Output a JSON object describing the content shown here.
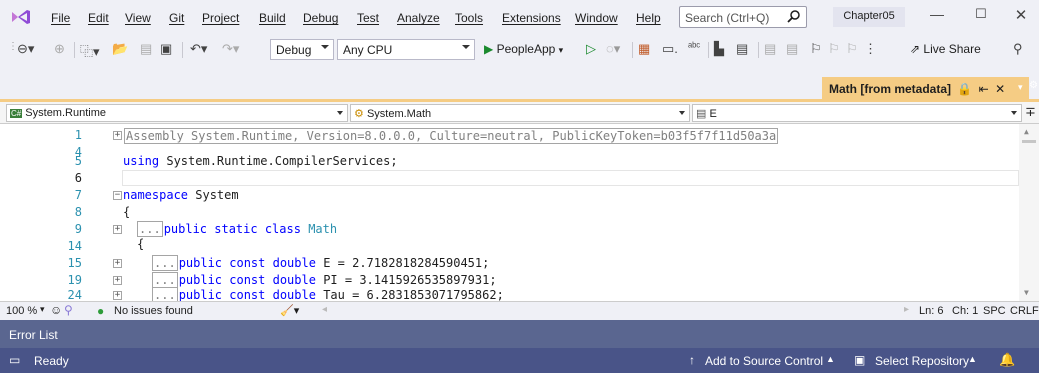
{
  "menu": {
    "items": [
      "File",
      "Edit",
      "View",
      "Git",
      "Project",
      "Build",
      "Debug",
      "Test",
      "Analyze",
      "Tools",
      "Extensions",
      "Window",
      "Help"
    ],
    "search_placeholder": "Search (Ctrl+Q)",
    "solution_name": "Chapter05"
  },
  "toolbar": {
    "config": "Debug",
    "platform": "Any CPU",
    "run_target": "PeopleApp",
    "live_share": "Live Share"
  },
  "tab": {
    "title": "Math [from metadata]"
  },
  "navbar": {
    "project": "System.Runtime",
    "type": "System.Math",
    "member": "E"
  },
  "code": {
    "lines": [
      {
        "num": "1",
        "text": "Assembly System.Runtime, Version=8.0.0.0, Culture=neutral, PublicKeyToken=b03f5f7f11d50a3a"
      },
      {
        "num": "4",
        "text": ""
      },
      {
        "num": "5",
        "text": "using System.Runtime.CompilerServices;"
      },
      {
        "num": "6",
        "text": ""
      },
      {
        "num": "7",
        "text": "namespace System"
      },
      {
        "num": "8",
        "text": "{"
      },
      {
        "num": "9",
        "text": "public static class Math"
      },
      {
        "num": "14",
        "text": "{"
      },
      {
        "num": "15",
        "text": "public const double E = 2.7182818284590451;"
      },
      {
        "num": "19",
        "text": "public const double PI = 3.1415926535897931;"
      },
      {
        "num": "24",
        "text": "public const double Tau = 6.2831853071795862;"
      }
    ],
    "collapsed_marker": "..."
  },
  "status_line": {
    "zoom": "100 %",
    "issues": "No issues found",
    "ln": "Ln: 6",
    "ch": "Ch: 1",
    "spc": "SPC",
    "crlf": "CRLF"
  },
  "error_list": {
    "title": "Error List"
  },
  "statusbar": {
    "ready": "Ready",
    "add_source": "Add to Source Control",
    "select_repo": "Select Repository"
  },
  "colors": {
    "accent_tab": "#f5cc84",
    "statusbar": "#495488",
    "errorlist": "#5a6690",
    "keyword": "#0000ff",
    "type": "#2b91af"
  }
}
